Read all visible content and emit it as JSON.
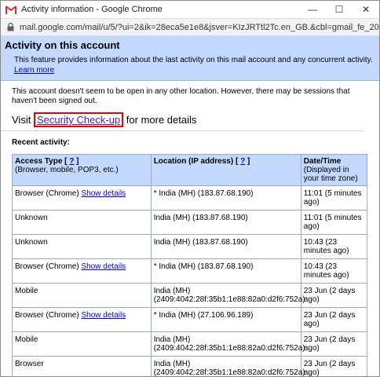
{
  "window": {
    "title": "Activity information - Google Chrome",
    "url": "mail.google.com/mail/u/5/?ui=2&ik=28eca5e1e8&jsver=KIzJRTtl2Tc.en_GB.&cbl=gmail_fe_20..."
  },
  "header": {
    "title": "Activity on this account",
    "description": "This feature provides information about the last activity on this mail account and any concurrent activity.",
    "learn_more": "Learn more"
  },
  "notice": "This account doesn't seem to be open in any other location. However, there may be sessions that haven't been signed out.",
  "visit": {
    "prefix": "Visit",
    "link": "Security Check-up",
    "suffix": "for more details"
  },
  "recent_label": "Recent activity:",
  "table": {
    "headers": {
      "access": "Access Type",
      "access_help": "?",
      "access_sub": "(Browser, mobile, POP3, etc.)",
      "location": "Location (IP address)",
      "location_help": "?",
      "date": "Date/Time",
      "date_sub": "(Displayed in your time zone)"
    },
    "rows": [
      {
        "access": "Browser (Chrome)",
        "details": "Show details",
        "location": "* India (MH) (183.87.68.190)",
        "date": "11:01 (5 minutes ago)"
      },
      {
        "access": "Unknown",
        "details": "",
        "location": "India (MH) (183.87.68.190)",
        "date": "11:01 (5 minutes ago)"
      },
      {
        "access": "Unknown",
        "details": "",
        "location": "India (MH) (183.87.68.190)",
        "date": "10:43 (23 minutes ago)"
      },
      {
        "access": "Browser (Chrome)",
        "details": "Show details",
        "location": "* India (MH) (183.87.68.190)",
        "date": "10:43 (23 minutes ago)"
      },
      {
        "access": "Mobile",
        "details": "",
        "location": "India (MH) (2409:4042:28f:35b1:1e88:82a0:d2f6:752a)",
        "date": "23 Jun (2 days ago)"
      },
      {
        "access": "Browser (Chrome)",
        "details": "Show details",
        "location": "* India (MH) (27.106.96.189)",
        "date": "23 Jun (2 days ago)"
      },
      {
        "access": "Mobile",
        "details": "",
        "location": "India (MH) (2409:4042:28f:35b1:1e88:82a0:d2f6:752a)",
        "date": "23 Jun (2 days ago)"
      },
      {
        "access": "Browser",
        "details": "",
        "location": "India (MH) (2409:4042:28f:35b1:1e88:82a0:d2f6:752a)",
        "date": "23 Jun (2 days ago)"
      }
    ]
  },
  "colors": {
    "header_bg": "#c3d9ff",
    "link": "#0000cc",
    "highlight_border": "#e00000"
  }
}
